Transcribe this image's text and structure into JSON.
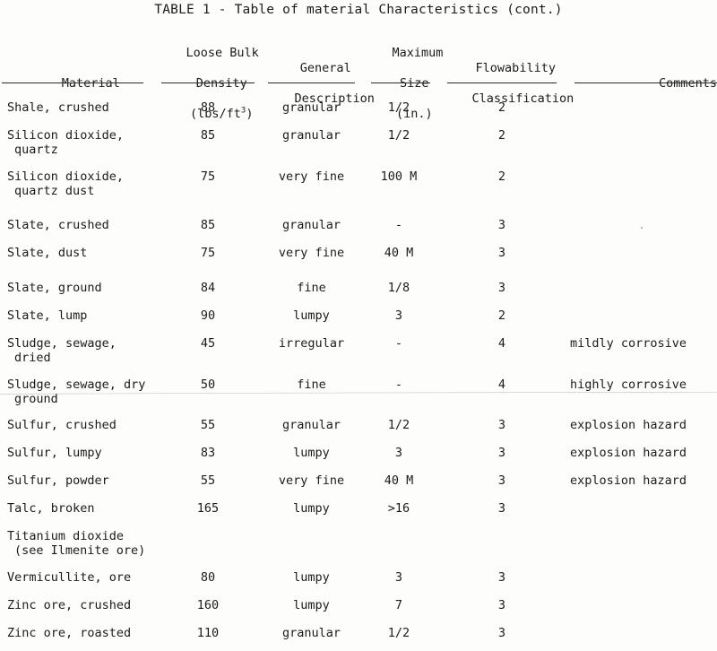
{
  "document": {
    "title": "TABLE 1 - Table of material Characteristics (cont.)"
  },
  "table": {
    "headers": {
      "material": "Material",
      "density_line1": "Loose Bulk",
      "density_line2": "Density",
      "density_line3_pre": "(lbs/ft",
      "density_line3_sup": "3",
      "density_line3_post": ")",
      "description_line1": "General",
      "description_line2": "Description",
      "size_line1": "Maximum",
      "size_line2": "Size",
      "size_line3": "(in.)",
      "flowability_line1": "Flowability",
      "flowability_line2": "Classification",
      "comments": "Comments"
    },
    "rows": [
      {
        "material": "Shale, crushed",
        "material_cont": "",
        "density": "88",
        "description": "granular",
        "size": "1/2",
        "flowability": "2",
        "comments": ""
      },
      {
        "material": "Silicon dioxide,",
        "material_cont": "quartz",
        "density": "85",
        "description": "granular",
        "size": "1/2",
        "flowability": "2",
        "comments": ""
      },
      {
        "material": "Silicon dioxide,",
        "material_cont": "quartz dust",
        "density": "75",
        "description": "very fine",
        "size": "100 M",
        "flowability": "2",
        "comments": ""
      },
      {
        "material": "Slate, crushed",
        "material_cont": "",
        "density": "85",
        "description": "granular",
        "size": "-",
        "flowability": "3",
        "comments": ""
      },
      {
        "material": "Slate, dust",
        "material_cont": "",
        "density": "75",
        "description": "very fine",
        "size": "40 M",
        "flowability": "3",
        "comments": ""
      },
      {
        "material": "Slate, ground",
        "material_cont": "",
        "density": "84",
        "description": "fine",
        "size": "1/8",
        "flowability": "3",
        "comments": ""
      },
      {
        "material": "Slate, lump",
        "material_cont": "",
        "density": "90",
        "description": "lumpy",
        "size": "3",
        "flowability": "2",
        "comments": ""
      },
      {
        "material": "Sludge, sewage,",
        "material_cont": "dried",
        "density": "45",
        "description": "irregular",
        "size": "-",
        "flowability": "4",
        "comments": "mildly corrosive"
      },
      {
        "material": "Sludge, sewage, dry",
        "material_cont": "ground",
        "density": "50",
        "description": "fine",
        "size": "-",
        "flowability": "4",
        "comments": "highly corrosive"
      },
      {
        "material": "Sulfur, crushed",
        "material_cont": "",
        "density": "55",
        "description": "granular",
        "size": "1/2",
        "flowability": "3",
        "comments": "explosion hazard"
      },
      {
        "material": "Sulfur, lumpy",
        "material_cont": "",
        "density": "83",
        "description": "lumpy",
        "size": "3",
        "flowability": "3",
        "comments": "explosion hazard"
      },
      {
        "material": "Sulfur, powder",
        "material_cont": "",
        "density": "55",
        "description": "very fine",
        "size": "40 M",
        "flowability": "3",
        "comments": "explosion hazard"
      },
      {
        "material": "Talc, broken",
        "material_cont": "",
        "density": "165",
        "description": "lumpy",
        "size": ">16",
        "flowability": "3",
        "comments": ""
      },
      {
        "material": "Titanium dioxide",
        "material_cont": "(see Ilmenite ore)",
        "density": "",
        "description": "",
        "size": "",
        "flowability": "",
        "comments": ""
      },
      {
        "material": "Vermicullite, ore",
        "material_cont": "",
        "density": "80",
        "description": "lumpy",
        "size": "3",
        "flowability": "3",
        "comments": ""
      },
      {
        "material": "Zinc ore, crushed",
        "material_cont": "",
        "density": "160",
        "description": "lumpy",
        "size": "7",
        "flowability": "3",
        "comments": ""
      },
      {
        "material": "Zinc ore, roasted",
        "material_cont": "",
        "density": "110",
        "description": "granular",
        "size": "1/2",
        "flowability": "3",
        "comments": ""
      }
    ]
  }
}
